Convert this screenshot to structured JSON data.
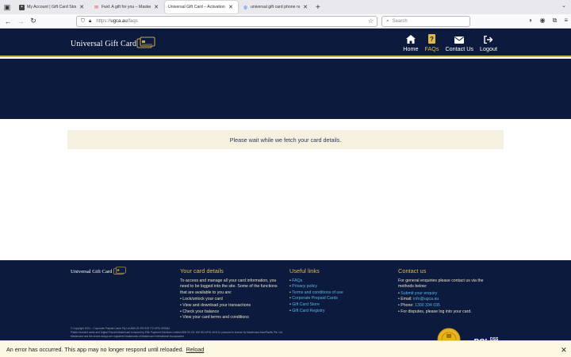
{
  "browser": {
    "tabs": [
      {
        "label": "My Account | Gift Card Store",
        "active": false,
        "favicon": "gift-card-favicon"
      },
      {
        "label": "Fwd: A gift for you – Mastercard",
        "active": false,
        "favicon": "mail-favicon"
      },
      {
        "label": "Universal Gift Card – Activation",
        "active": true,
        "favicon": "none"
      },
      {
        "label": "universal gift card phone numb",
        "active": false,
        "favicon": "google-favicon"
      }
    ],
    "url_host": "https://",
    "url_domain": "ugca.au",
    "url_path": "/faqs",
    "search_placeholder": "Search"
  },
  "header": {
    "brand": "Universal Gift Card",
    "nav": [
      {
        "label": "Home",
        "icon": "home-icon",
        "active": false
      },
      {
        "label": "FAQs",
        "icon": "faq-icon",
        "active": true
      },
      {
        "label": "Contact Us",
        "icon": "mail-icon",
        "active": false
      },
      {
        "label": "Logout",
        "icon": "logout-icon",
        "active": false
      }
    ]
  },
  "main": {
    "notice": "Please wait while we fetch your card details."
  },
  "footer": {
    "brand": "Universal Gift Card",
    "card_details": {
      "title": "Your card details",
      "intro": "To access and manage all your card information, you need to be logged into the site. Some of the functions that are available to you are:",
      "items": [
        "Lock/unlock your card",
        "View and download your transactions",
        "Check your balance",
        "View your card terms and conditions"
      ]
    },
    "useful_links": {
      "title": "Useful links",
      "items": [
        "FAQs",
        "Privacy policy",
        "Terms and conditions of use",
        "Corporate Prepaid Cards",
        "Gift Card Store",
        "Gift Card Registry"
      ]
    },
    "contact": {
      "title": "Contact us",
      "intro": "For general enquiries please contact us via the methods below:",
      "submit_label": "Submit your enquiry",
      "email_label": "Email: ",
      "email": "info@ugca.au",
      "phone_label": "Phone: ",
      "phone": "1300 334 035",
      "disputes": "For disputes, please log into your card."
    },
    "legal_1": "© Copyright 2024 – Corporate Prepaid Cards Pty Ltd ABN 25 092 928 772 AFSL 509642.",
    "legal_2": "Plastic branded cards and Digital Prepaid Mastercard is issued by EML Payment Solutions Limited ABN 30 131 436 532 AFSL 404131 pursuant to license by Mastercard Asia/Pacific Pte. Ltd.",
    "legal_3": "Mastercard and the circles design are registered trademarks of Mastercard International Incorporated.",
    "pci_label": "DSS"
  },
  "error_banner": {
    "message": "An error has occurred. This app may no longer respond until reloaded.",
    "reload_label": "Reload",
    "dismiss": "🗙"
  },
  "colors": {
    "navy": "#0b1a3d",
    "gold": "#e0b84c",
    "notice_bg": "#f5f0e0",
    "link": "#5db3e8"
  }
}
